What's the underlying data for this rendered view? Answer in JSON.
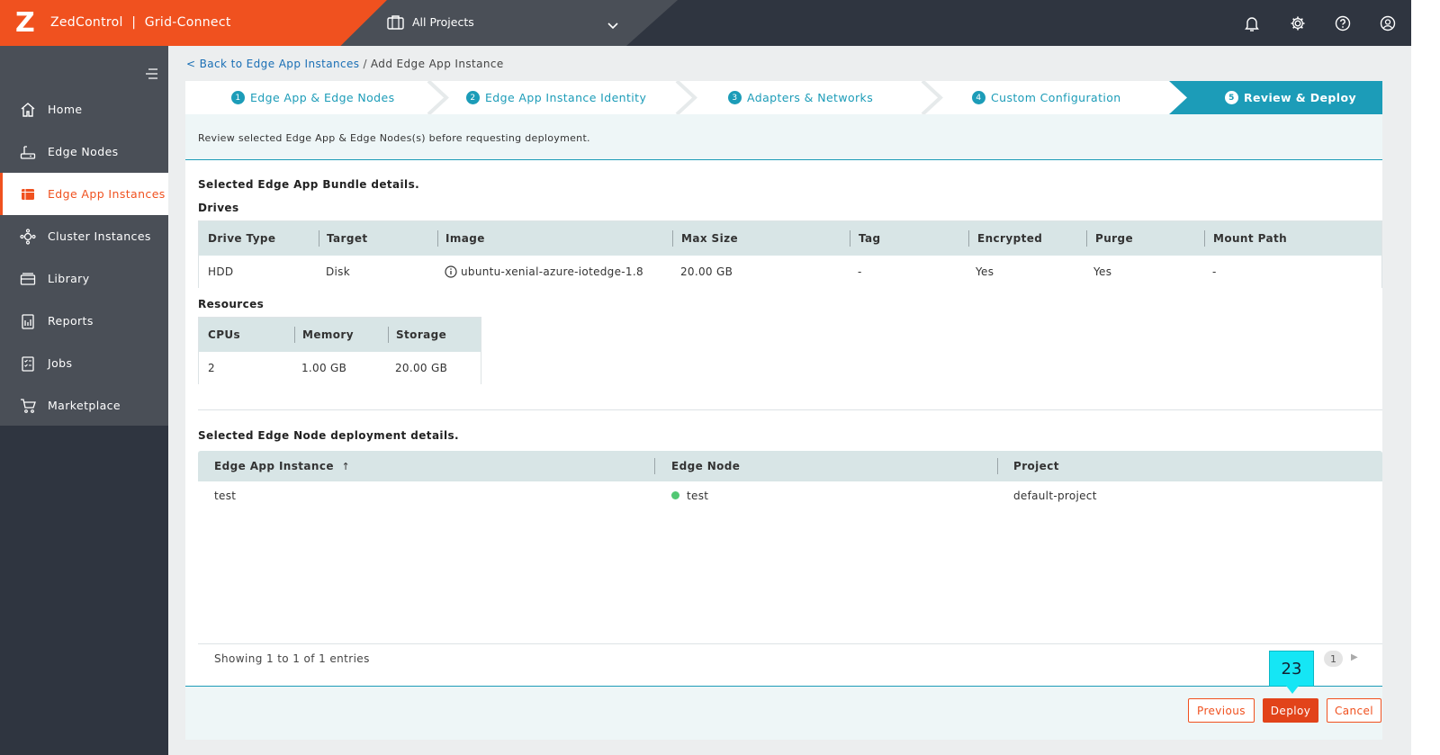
{
  "header": {
    "logo": "Z",
    "brand": "ZedControl  |  Grid-Connect",
    "project_selector": "All Projects",
    "icons": [
      "bell-icon",
      "gear-icon",
      "help-icon",
      "user-icon"
    ]
  },
  "colors": {
    "brand": "#f0511f",
    "accent": "#1c9cb8",
    "sidebar": "#4a4f57",
    "status_online": "#52c873"
  },
  "sidebar": {
    "items": [
      {
        "label": "Home",
        "icon": "home-icon",
        "active": false
      },
      {
        "label": "Edge Nodes",
        "icon": "edge-node-icon",
        "active": false
      },
      {
        "label": "Edge App Instances",
        "icon": "app-instance-icon",
        "active": true
      },
      {
        "label": "Cluster Instances",
        "icon": "cluster-icon",
        "active": false
      },
      {
        "label": "Library",
        "icon": "library-icon",
        "active": false
      },
      {
        "label": "Reports",
        "icon": "reports-icon",
        "active": false
      },
      {
        "label": "Jobs",
        "icon": "jobs-icon",
        "active": false
      },
      {
        "label": "Marketplace",
        "icon": "cart-icon",
        "active": false
      }
    ]
  },
  "breadcrumb": {
    "back": "< Back to Edge App Instances",
    "sep": "/",
    "current": "Add Edge App Instance"
  },
  "steps": [
    {
      "num": "1",
      "label": "Edge App & Edge Nodes"
    },
    {
      "num": "2",
      "label": "Edge App Instance Identity"
    },
    {
      "num": "3",
      "label": "Adapters & Networks"
    },
    {
      "num": "4",
      "label": "Custom Configuration"
    },
    {
      "num": "5",
      "label": "Review & Deploy"
    }
  ],
  "review": {
    "message": "Review selected Edge App & Edge Nodes(s) before requesting deployment.",
    "bundle_title": "Selected Edge App Bundle details.",
    "drives_title": "Drives",
    "drives_headers": [
      "Drive Type",
      "Target",
      "Image",
      "Max Size",
      "Tag",
      "Encrypted",
      "Purge",
      "Mount Path"
    ],
    "drives_row": [
      "HDD",
      "Disk",
      "ubuntu-xenial-azure-iotedge-1.8",
      "20.00 GB",
      "-",
      "Yes",
      "Yes",
      "-"
    ],
    "resources_title": "Resources",
    "resources_headers": [
      "CPUs",
      "Memory",
      "Storage"
    ],
    "resources_row": [
      "2",
      "1.00 GB",
      "20.00 GB"
    ],
    "node_title": "Selected Edge Node deployment details.",
    "node_headers": [
      "Edge App Instance",
      "Edge Node",
      "Project"
    ],
    "node_sort_icon": "↑",
    "node_row": [
      "test",
      "test",
      "default-project"
    ],
    "entries": "Showing 1 to 1 of 1 entries",
    "page": "1"
  },
  "actions": {
    "previous": "Previous",
    "deploy": "Deploy",
    "cancel": "Cancel"
  },
  "callout": "23"
}
